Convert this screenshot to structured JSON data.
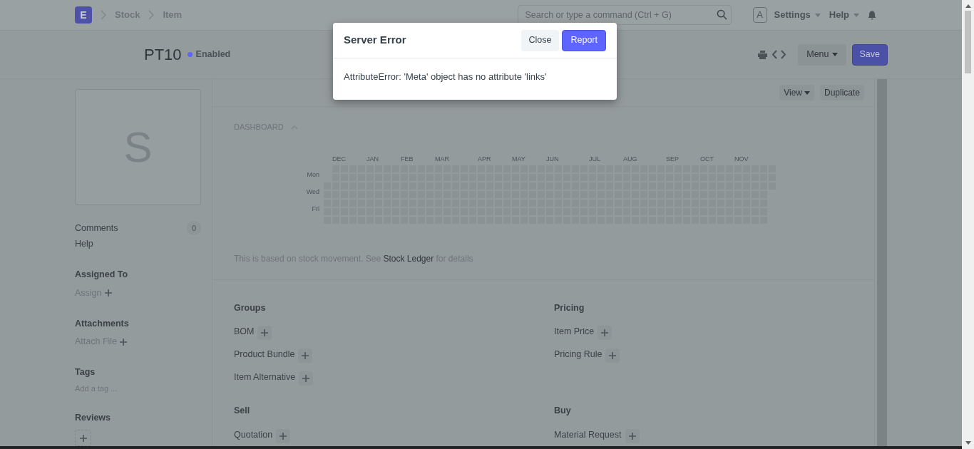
{
  "navbar": {
    "logo": "E",
    "breadcrumbs": [
      "Stock",
      "Item"
    ],
    "search": {
      "placeholder": "Search or type a command (Ctrl + G)"
    },
    "avatar": "A",
    "menus": [
      "Settings",
      "Help"
    ]
  },
  "page_head": {
    "title": "PT10",
    "status": {
      "label": "Enabled",
      "color": "#5e64ff"
    },
    "menu_button": "Menu",
    "save_button": "Save"
  },
  "sidebar": {
    "image_letter": "S",
    "comments": {
      "label": "Comments",
      "count": "0"
    },
    "help": "Help",
    "sections": [
      {
        "title": "Assigned To",
        "action": "Assign",
        "kind": "plus"
      },
      {
        "title": "Attachments",
        "action": "Attach File",
        "kind": "plus"
      },
      {
        "title": "Tags",
        "action": "Add a tag ...",
        "kind": "text"
      },
      {
        "title": "Reviews",
        "kind": "box"
      }
    ]
  },
  "toolbar": {
    "buttons": [
      "View",
      "Duplicate"
    ]
  },
  "dashboard": {
    "heading": "DASHBOARD",
    "months": [
      "DEC",
      "JAN",
      "FEB",
      "MAR",
      "APR",
      "MAY",
      "JUN",
      "JUL",
      "AUG",
      "SEP",
      "OCT",
      "NOV"
    ],
    "days": [
      "Mon",
      "Wed",
      "Fri"
    ],
    "note": {
      "before": "This is based on stock movement. See",
      "link": "Stock Ledger",
      "after": "for details"
    }
  },
  "connections": [
    {
      "title": "Groups",
      "items": [
        "BOM",
        "Product Bundle",
        "Item Alternative"
      ]
    },
    {
      "title": "Pricing",
      "items": [
        "Item Price",
        "Pricing Rule"
      ]
    },
    {
      "title": "Sell",
      "items": [
        "Quotation"
      ]
    },
    {
      "title": "Buy",
      "items": [
        "Material Request"
      ]
    }
  ],
  "modal": {
    "title": "Server Error",
    "buttons": [
      {
        "label": "Close",
        "kind": "secondary"
      },
      {
        "label": "Report",
        "kind": "primary"
      }
    ],
    "message": "AttributeError: 'Meta' object has no attribute 'links'"
  }
}
